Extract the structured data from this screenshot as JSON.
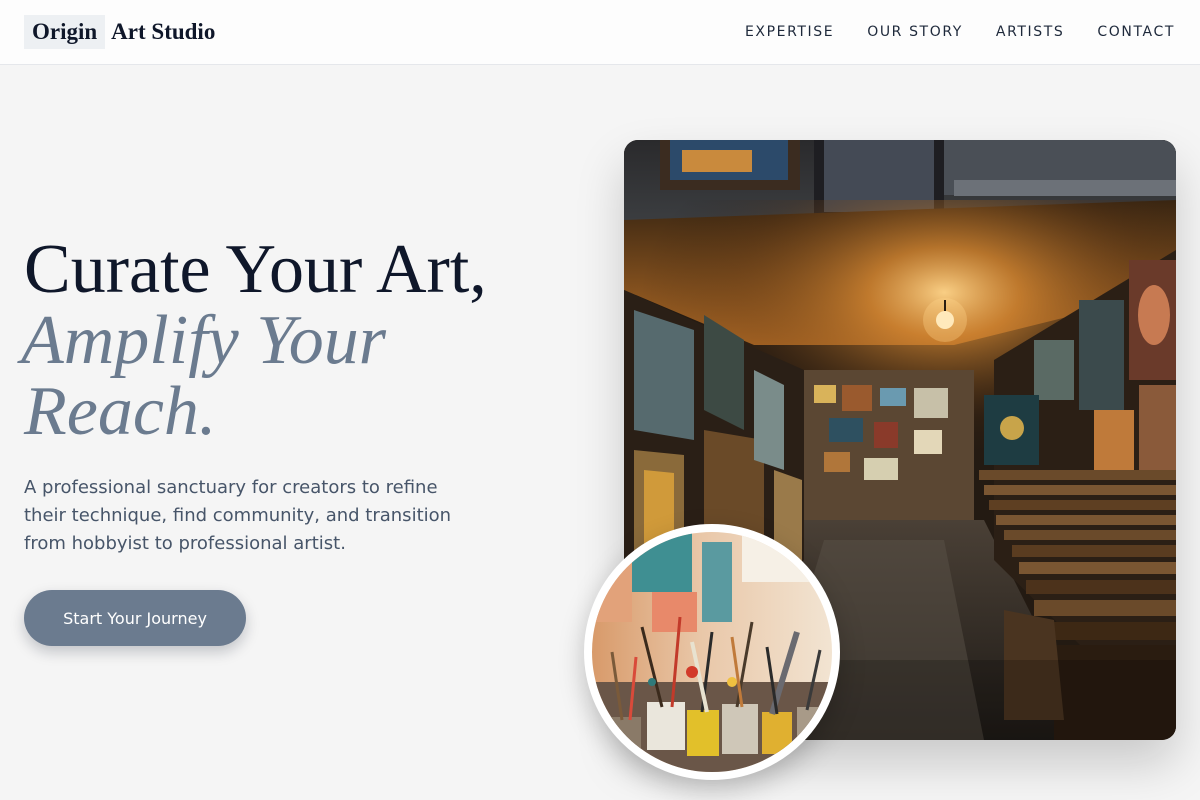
{
  "header": {
    "logo_boxed": "Origin",
    "logo_rest": "Art Studio",
    "nav": [
      {
        "label": "EXPERTISE"
      },
      {
        "label": "OUR STORY"
      },
      {
        "label": "ARTISTS"
      },
      {
        "label": "CONTACT"
      }
    ]
  },
  "hero": {
    "title_line1": "Curate Your Art,",
    "title_line2": "Amplify Your",
    "title_line3": "Reach.",
    "description": "A professional sanctuary for creators to refine their technique, find community, and transition from hobbyist to professional artist.",
    "cta_label": "Start Your Journey"
  },
  "colors": {
    "background": "#f5f5f5",
    "heading": "#0f172a",
    "accent": "#6b7b8f",
    "body_text": "#475569"
  },
  "images": {
    "gallery": "art-gallery-corridor-photo",
    "studio": "paint-brushes-jars-photo"
  }
}
